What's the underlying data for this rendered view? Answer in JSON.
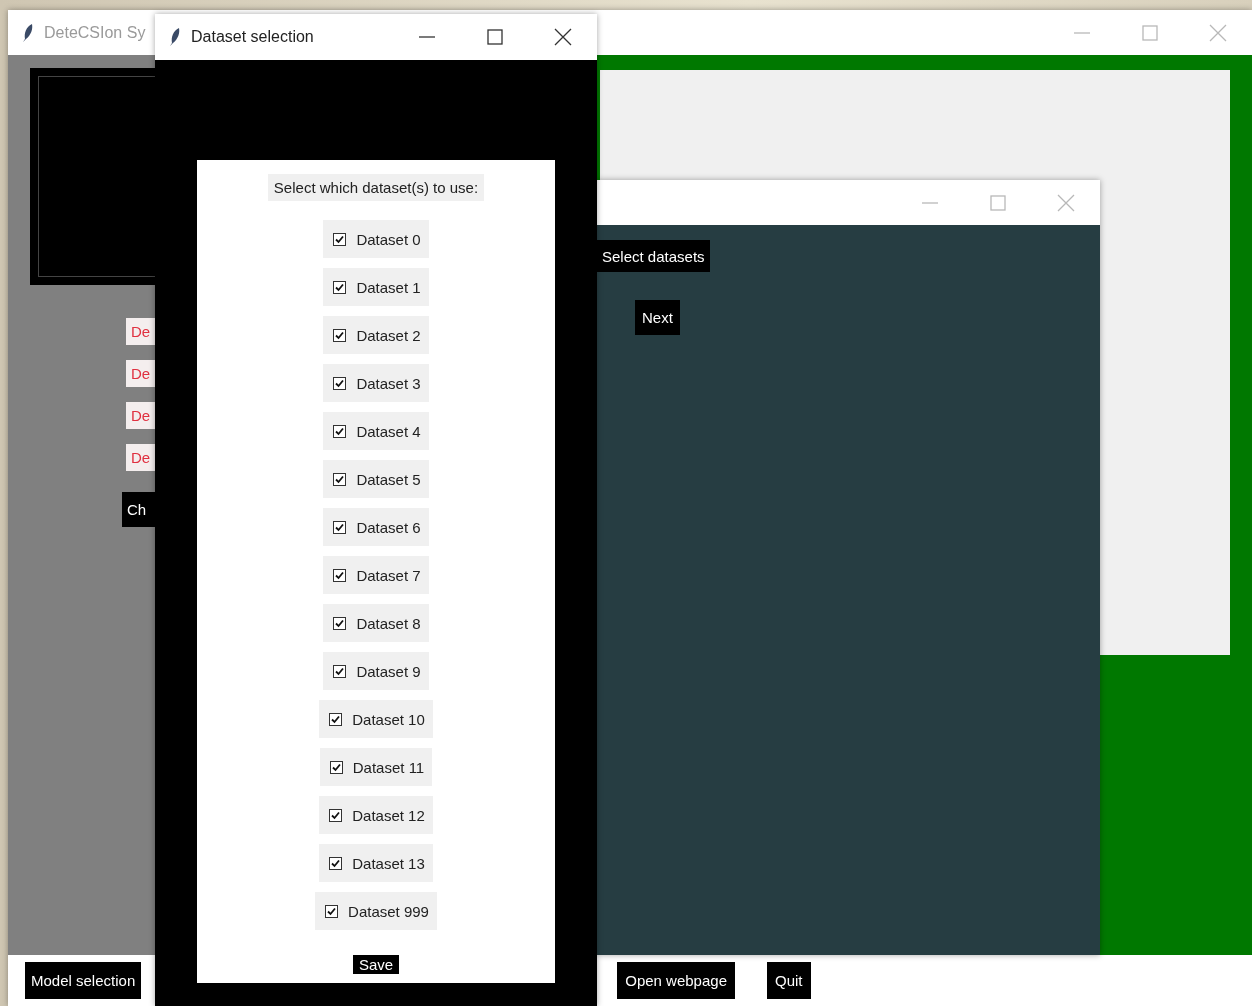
{
  "main_window": {
    "title": "DeteCSIon Sy",
    "side_buttons": [
      {
        "label": "De"
      },
      {
        "label": "De"
      },
      {
        "label": "De"
      },
      {
        "label": "De"
      }
    ],
    "dark_button": "Ch",
    "bottom_buttons": [
      "Model selection",
      "Open webpage",
      "Quit"
    ]
  },
  "dataset_window": {
    "title": "Dataset selection",
    "prompt": "Select which dataset(s) to use:",
    "datasets": [
      {
        "label": "Dataset 0",
        "checked": true
      },
      {
        "label": "Dataset 1",
        "checked": true
      },
      {
        "label": "Dataset 2",
        "checked": true
      },
      {
        "label": "Dataset 3",
        "checked": true
      },
      {
        "label": "Dataset 4",
        "checked": true
      },
      {
        "label": "Dataset 5",
        "checked": true
      },
      {
        "label": "Dataset 6",
        "checked": true
      },
      {
        "label": "Dataset 7",
        "checked": true
      },
      {
        "label": "Dataset 8",
        "checked": true
      },
      {
        "label": "Dataset 9",
        "checked": true
      },
      {
        "label": "Dataset 10",
        "checked": true
      },
      {
        "label": "Dataset 11",
        "checked": true
      },
      {
        "label": "Dataset 12",
        "checked": true
      },
      {
        "label": "Dataset 13",
        "checked": true
      },
      {
        "label": "Dataset 999",
        "checked": true
      }
    ],
    "save_button": "Save"
  },
  "wizard_window": {
    "buttons": [
      "Select datasets",
      "Next"
    ]
  }
}
